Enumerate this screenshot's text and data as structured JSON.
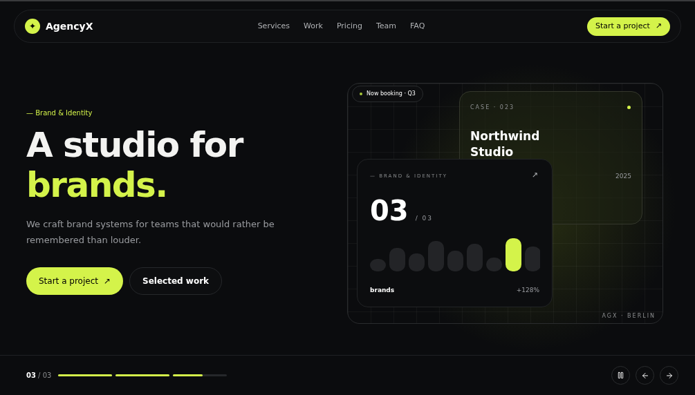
{
  "brand": {
    "name": "AgencyX",
    "mark": "✦"
  },
  "nav": [
    "Services",
    "Work",
    "Pricing",
    "Team",
    "FAQ"
  ],
  "header_cta": {
    "label": "Start a project",
    "icon": "↗"
  },
  "hero": {
    "eyebrow": "— Brand & Identity",
    "title_line1": "A studio for",
    "title_line2": "brands.",
    "body": "We craft brand systems for teams that would rather be remembered than louder.",
    "buttons": [
      {
        "label": "Start a project",
        "icon": "↗",
        "kind": "primary"
      },
      {
        "label": "Selected work",
        "kind": "secondary"
      }
    ]
  },
  "showcase": {
    "badge": "Now booking · Q3",
    "corner": "AGX · BERLIN",
    "case_card": {
      "label": "CASE · 023",
      "title_line1": "Northwind",
      "title_line2": "Studio",
      "year": "2025"
    },
    "stat_card": {
      "label": "— BRAND & IDENTITY",
      "icon": "↗",
      "number": "03",
      "total": "/ 03",
      "caption": "brands",
      "delta": "+128%"
    }
  },
  "footer": {
    "current": "03",
    "total": "/ 03",
    "progress": [
      {
        "level": 1
      },
      {
        "level": 1
      },
      {
        "level": 0.55
      }
    ]
  }
}
